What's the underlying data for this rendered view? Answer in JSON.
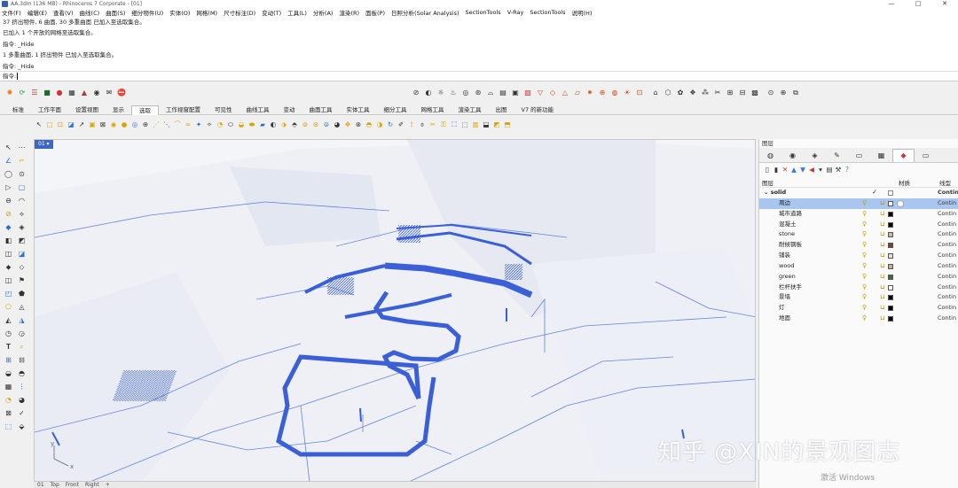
{
  "window": {
    "title": "AA.3dm (136 MB) - Rhinoceros 7 Corporate - [01]",
    "controls": [
      "—",
      "□",
      "✕"
    ]
  },
  "menu": [
    "文件(F)",
    "编辑(E)",
    "查看(V)",
    "曲线(C)",
    "曲面(S)",
    "细分物件(U)",
    "实体(O)",
    "网格(M)",
    "尺寸标注(D)",
    "变动(T)",
    "工具(L)",
    "分析(A)",
    "渲染(R)",
    "面板(P)",
    "日照分析(Solar Analysis)",
    "SectionTools",
    "V-Ray",
    "SectionTools",
    "说明(H)"
  ],
  "command": {
    "history": [
      "37 挤出物件, 6 曲面, 30 多重曲面 已加入至选取集合。",
      "已加入 1 个开放的网格至选取集合。",
      "指令: _Hide",
      "1 多重曲面, 1 挤出物件 已加入至选取集合。",
      "指令: _Hide"
    ],
    "prompt": "指令:"
  },
  "toolbar_tabs": [
    "标准",
    "工作平面",
    "设置视图",
    "显示",
    "选取",
    "工作视窗配置",
    "可见性",
    "曲线工具",
    "变动",
    "曲面工具",
    "实体工具",
    "细分工具",
    "网格工具",
    "渲染工具",
    "出图",
    "V7 的新功能"
  ],
  "active_tab": "选取",
  "viewport": {
    "label": "01 ▾",
    "tabs": [
      "01",
      "Top",
      "Front",
      "Right",
      "+"
    ],
    "axis_x": "x",
    "axis_y": "y",
    "line_color": "#3a5fd6"
  },
  "watermark": "知乎 @XIN的景观图志",
  "activate_windows": "激活 Windows",
  "layers_panel": {
    "title": "图层",
    "tab_icons": [
      "color-wheel-icon",
      "camera-icon",
      "material-icon",
      "pen-icon",
      "folder-icon",
      "grid-icon",
      "layers-icon",
      "monitor-icon"
    ],
    "columns": {
      "name": "图层",
      "material": "材质",
      "linetype": "线型"
    },
    "parent": {
      "name": "solid",
      "linetype": "Contin"
    },
    "layers": [
      {
        "name": "周边",
        "color": "#ffffff",
        "linetype": "Contin",
        "current": true
      },
      {
        "name": "城市道路",
        "color": "#000000",
        "linetype": "Contin",
        "current": false
      },
      {
        "name": "混凝土",
        "color": "#000000",
        "linetype": "Contin",
        "current": false
      },
      {
        "name": "stone",
        "color": "#c9b89a",
        "linetype": "Contin",
        "current": false
      },
      {
        "name": "耐候钢板",
        "color": "#8b3a2a",
        "linetype": "Contin",
        "current": false
      },
      {
        "name": "铺装",
        "color": "#e6e0d4",
        "linetype": "Contin",
        "current": false
      },
      {
        "name": "wood",
        "color": "#c4b08c",
        "linetype": "Contin",
        "current": false
      },
      {
        "name": "green",
        "color": "#3f6b3a",
        "linetype": "Contin",
        "current": false
      },
      {
        "name": "栏杆扶手",
        "color": "#ffffff",
        "linetype": "Contin",
        "current": false
      },
      {
        "name": "景墙",
        "color": "#000000",
        "linetype": "Contin",
        "current": false
      },
      {
        "name": "灯",
        "color": "#000000",
        "linetype": "Contin",
        "current": false
      },
      {
        "name": "地面",
        "color": "#000000",
        "linetype": "Contin",
        "current": false
      }
    ]
  }
}
